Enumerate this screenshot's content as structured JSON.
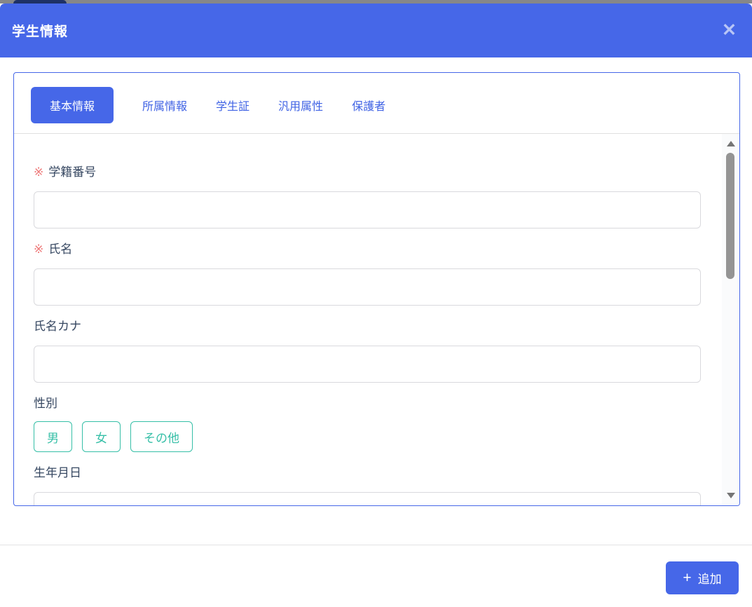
{
  "modal": {
    "title": "学生情報",
    "close_icon": "✕",
    "tabs": [
      {
        "label": "基本情報",
        "active": true
      },
      {
        "label": "所属情報",
        "active": false
      },
      {
        "label": "学生証",
        "active": false
      },
      {
        "label": "汎用属性",
        "active": false
      },
      {
        "label": "保護者",
        "active": false
      }
    ],
    "form": {
      "required_marker": "※",
      "fields": [
        {
          "label": "学籍番号",
          "required": true,
          "type": "text",
          "value": ""
        },
        {
          "label": "氏名",
          "required": true,
          "type": "text",
          "value": ""
        },
        {
          "label": "氏名カナ",
          "required": false,
          "type": "text",
          "value": ""
        },
        {
          "label": "性別",
          "required": false,
          "type": "buttons",
          "options": [
            "男",
            "女",
            "その他"
          ]
        },
        {
          "label": "生年月日",
          "required": false,
          "type": "text",
          "value": ""
        }
      ]
    },
    "footer": {
      "add_icon": "+",
      "add_label": "追加"
    }
  },
  "colors": {
    "primary_blue": "#4667e8",
    "tab_text_blue": "#3f62e4",
    "teal_accent": "#36bfa7",
    "required_red": "#ee7b7b",
    "label_navy": "#364761"
  }
}
